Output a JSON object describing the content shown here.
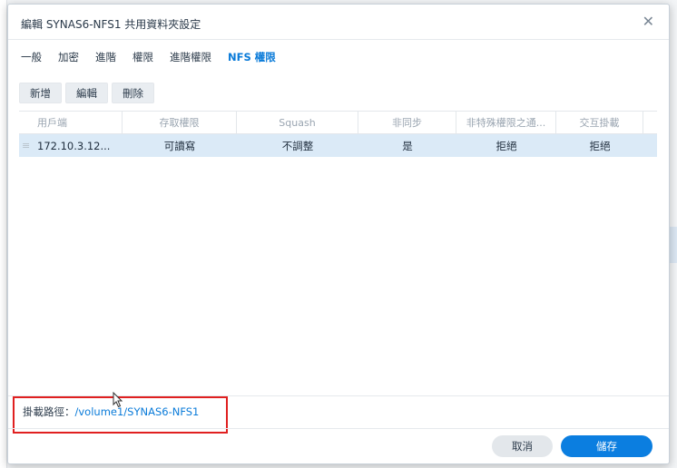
{
  "dialog": {
    "title": "編輯 SYNAS6-NFS1 共用資料夾設定",
    "close_icon": "close-icon"
  },
  "tabs": [
    {
      "label": "一般",
      "active": false
    },
    {
      "label": "加密",
      "active": false
    },
    {
      "label": "進階",
      "active": false
    },
    {
      "label": "權限",
      "active": false
    },
    {
      "label": "進階權限",
      "active": false
    },
    {
      "label": "NFS 權限",
      "active": true
    }
  ],
  "toolbar": {
    "add_label": "新增",
    "edit_label": "編輯",
    "delete_label": "刪除"
  },
  "table": {
    "columns": [
      "用戶端",
      "存取權限",
      "Squash",
      "非同步",
      "非特殊權限之通...",
      "交互掛載"
    ],
    "rows": [
      [
        "172.10.3.12...",
        "可讀寫",
        "不調整",
        "是",
        "拒絕",
        "拒絕"
      ]
    ]
  },
  "mount_path": {
    "label": "掛載路徑：",
    "value": "/volume1/SYNAS6-NFS1"
  },
  "footer": {
    "cancel_label": "取消",
    "save_label": "儲存"
  },
  "colors": {
    "accent": "#0b7ee0",
    "selected_row": "#dbeaf7",
    "highlight_box": "#e02020"
  }
}
